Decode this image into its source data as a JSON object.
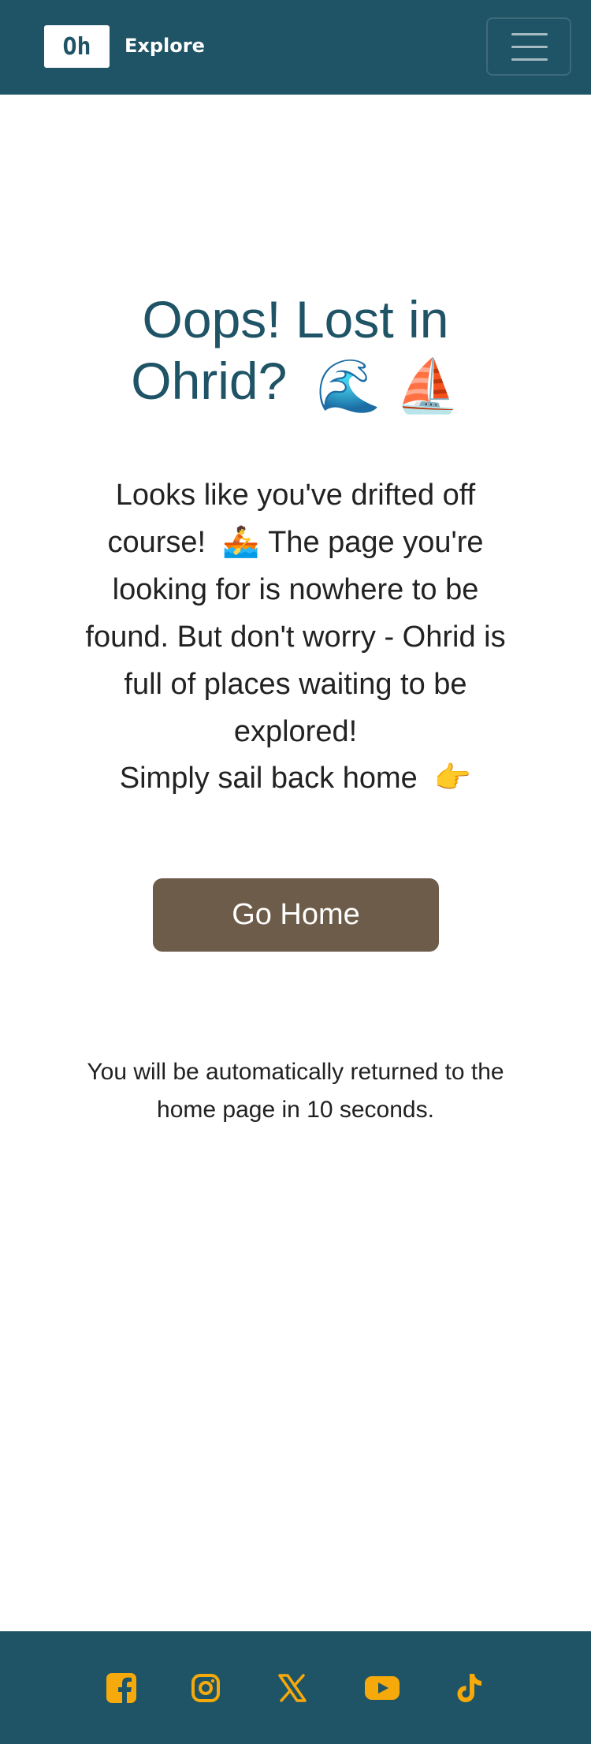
{
  "header": {
    "logo_text": "Oh",
    "brand_text": "Explore",
    "menu_icon": "hamburger-menu-icon"
  },
  "main": {
    "title_text": "Oops! Lost in Ohrid?",
    "title_emojis": [
      "🌊",
      "⛵"
    ],
    "description_text": "Looks like you've drifted off course!",
    "description_emoji": "🚣",
    "description_rest": "The page you're looking for is nowhere to be found. But don't worry - Ohrid is full of places waiting to be explored!",
    "description_line2": "Simply sail back home",
    "description_line2_emoji": "👉",
    "button_label": "Go Home",
    "redirect_text": "You will be automatically returned to the home page in 10 seconds."
  },
  "footer": {
    "social_icons": [
      "facebook-icon",
      "instagram-icon",
      "x-icon",
      "youtube-icon",
      "tiktok-icon"
    ]
  },
  "colors": {
    "header_bg": "#1f5466",
    "title": "#1f5466",
    "button_bg": "#6e5c4a",
    "social_icon": "#f5a90a"
  }
}
